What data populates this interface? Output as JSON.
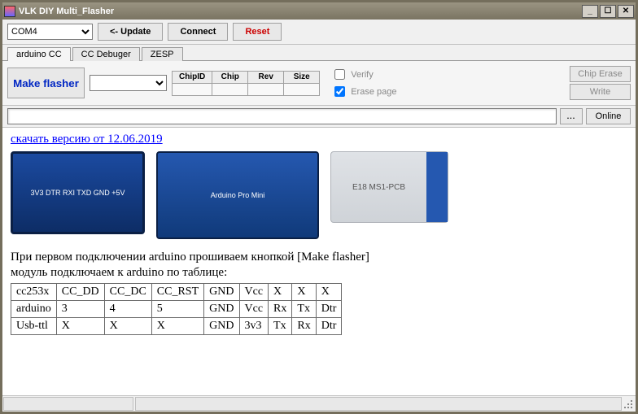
{
  "window": {
    "title": "VLK DIY Multi_Flasher"
  },
  "toolbar": {
    "port_selected": "COM4",
    "update_label": "<- Update",
    "connect_label": "Connect",
    "reset_label": "Reset"
  },
  "tabs": [
    {
      "label": "arduino CC",
      "active": true
    },
    {
      "label": "CC Debuger",
      "active": false
    },
    {
      "label": "ZESP",
      "active": false
    }
  ],
  "flasher": {
    "make_label": "Make flasher",
    "info_headers": [
      "ChipID",
      "Chip",
      "Rev",
      "Size"
    ],
    "verify_label": "Verify",
    "verify_checked": false,
    "erase_label": "Erase page",
    "erase_checked": true,
    "chip_erase_label": "Chip Erase",
    "write_label": "Write"
  },
  "path": {
    "value": "",
    "ellipsis": "...",
    "online_label": "Online"
  },
  "doc": {
    "download_link": "скачать версию от 12.06.2019",
    "instr1": "При первом подключении arduino прошиваем кнопкой [Make flasher]",
    "instr2": "модуль подключаем к arduino по таблице:",
    "pinmap": [
      [
        "cc253x",
        "CC_DD",
        "CC_DC",
        "CC_RST",
        "GND",
        "Vcc",
        "X",
        "X",
        "X"
      ],
      [
        "arduino",
        "3",
        "4",
        "5",
        "GND",
        "Vcc",
        "Rx",
        "Tx",
        "Dtr"
      ],
      [
        "Usb-ttl",
        "X",
        "X",
        "X",
        "GND",
        "3v3",
        "Tx",
        "Rx",
        "Dtr"
      ]
    ],
    "board_labels": {
      "b1": "3V3 DTR RXI TXD GND +5V",
      "b2": "Arduino Pro Mini",
      "b3": "E18 MS1-PCB"
    }
  }
}
